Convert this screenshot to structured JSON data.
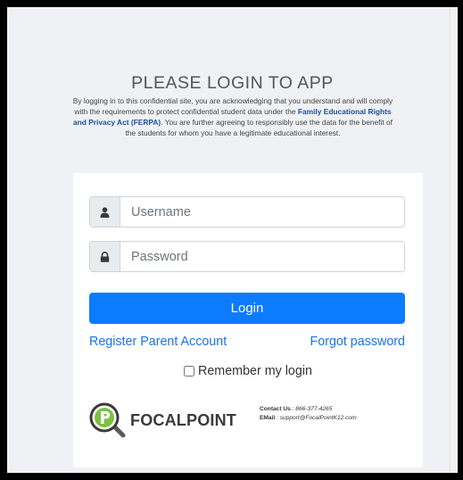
{
  "login": {
    "title": "PLEASE LOGIN TO APP",
    "disclaimer_part1": "By logging in to this confidential site, you are acknowledging that you understand and will comply with the requirements to protect confidential student data under the ",
    "disclaimer_link": "Family Educational Rights and Privacy Act (FERPA)",
    "disclaimer_part2": ". You are further agreeing to responsibly use the data for the benefit of the students for whom you have a legitimate educational interest.",
    "username_placeholder": "Username",
    "password_placeholder": "Password",
    "login_label": "Login",
    "register_label": "Register Parent Account",
    "forgot_label": "Forgot password",
    "remember_label": "Remember my login"
  },
  "footer": {
    "logo_text": "FOCALPOINT",
    "contact_label": "Contact Us",
    "contact_value": " : 866-377-4265",
    "email_label": "EMail",
    "email_value": " : support@FocalPointK12.com"
  },
  "colors": {
    "accent": "#0d7bff",
    "link": "#1a73e8",
    "logo_green": "#7cc142"
  },
  "icons": [
    "user-icon",
    "lock-icon",
    "focalpoint-logo-icon"
  ]
}
